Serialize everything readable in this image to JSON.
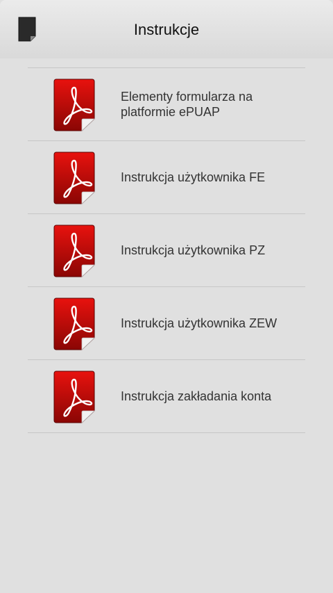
{
  "header": {
    "title": "Instrukcje",
    "icon": "document-icon"
  },
  "documents": [
    {
      "label": "Elementy formularza na platformie ePUAP",
      "icon": "pdf-icon"
    },
    {
      "label": "Instrukcja użytkownika FE",
      "icon": "pdf-icon"
    },
    {
      "label": "Instrukcja użytkownika PZ",
      "icon": "pdf-icon"
    },
    {
      "label": "Instrukcja użytkownika ZEW",
      "icon": "pdf-icon"
    },
    {
      "label": "Instrukcja zakładania konta",
      "icon": "pdf-icon"
    }
  ],
  "colors": {
    "pdf_red": "#c8100e",
    "background": "#e0e0e0"
  }
}
